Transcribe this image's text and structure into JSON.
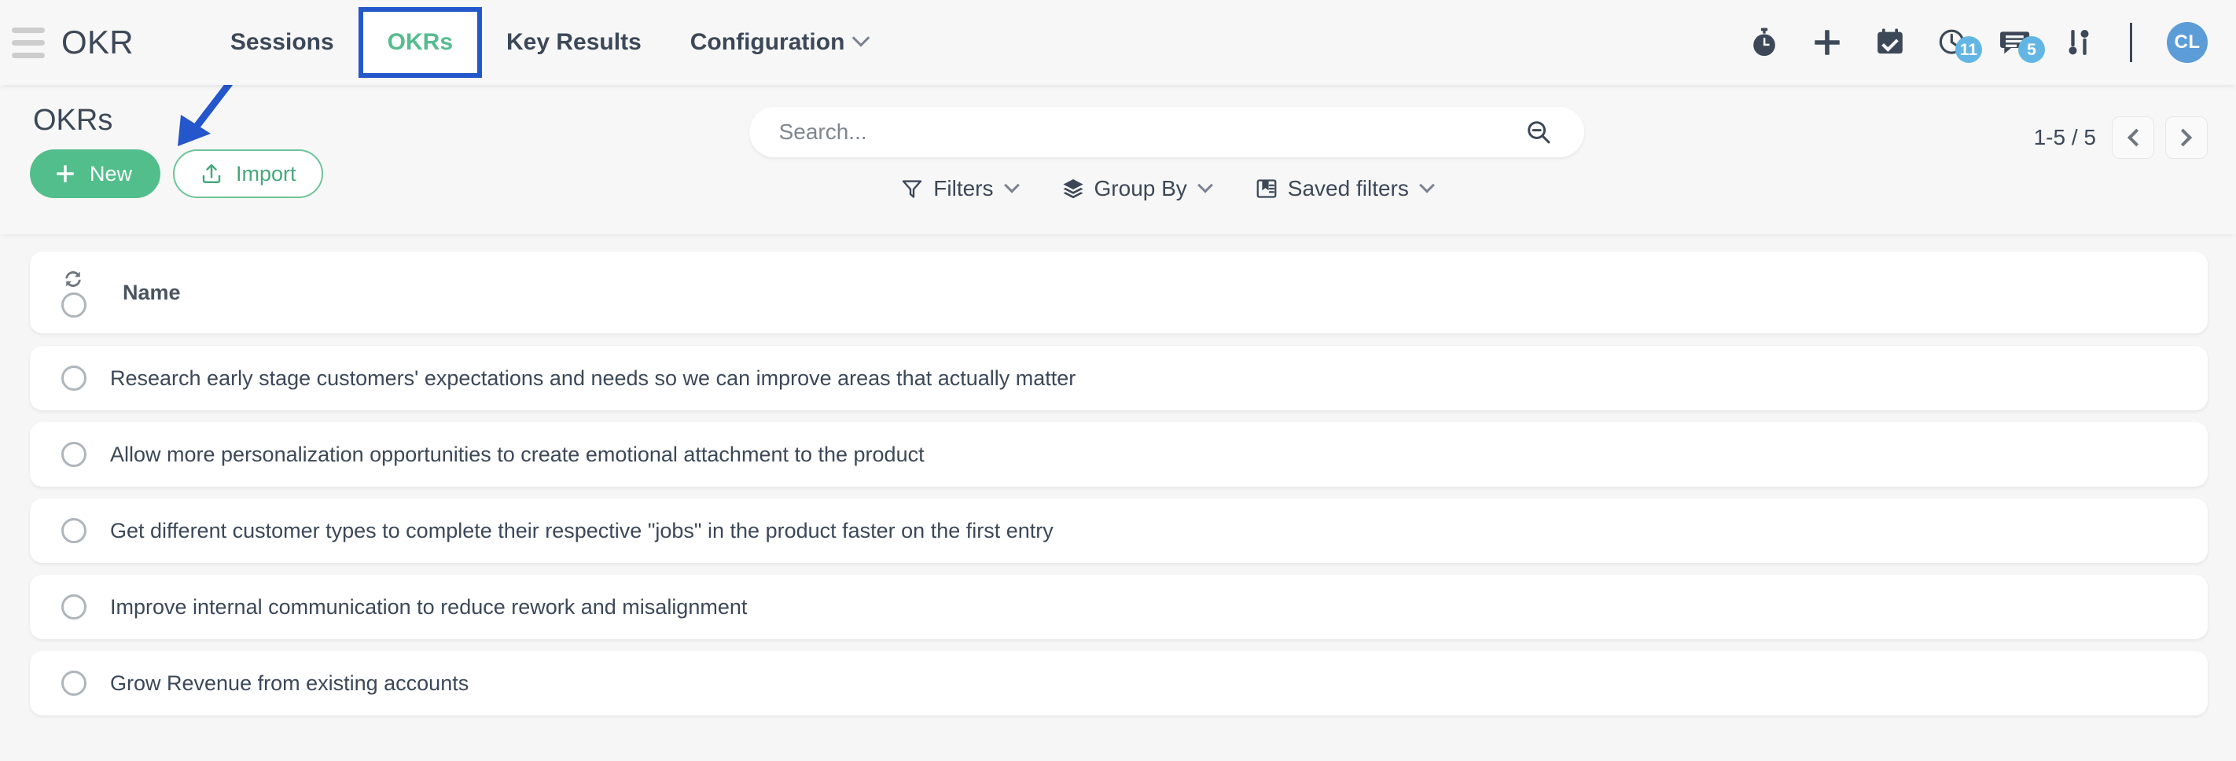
{
  "navbar": {
    "menu_icon": "hamburger-icon",
    "brand": "OKR",
    "items": [
      {
        "label": "Sessions",
        "active": false,
        "has_chevron": false,
        "highlighted": false
      },
      {
        "label": "OKRs",
        "active": true,
        "has_chevron": false,
        "highlighted": true
      },
      {
        "label": "Key Results",
        "active": false,
        "has_chevron": false,
        "highlighted": false
      },
      {
        "label": "Configuration",
        "active": false,
        "has_chevron": true,
        "highlighted": false
      }
    ],
    "tools": [
      {
        "name": "stopwatch-icon",
        "badge": null
      },
      {
        "name": "plus-icon",
        "badge": null
      },
      {
        "name": "calendar-check-icon",
        "badge": null
      },
      {
        "name": "clock-activity-icon",
        "badge": "11"
      },
      {
        "name": "messages-icon",
        "badge": "5"
      },
      {
        "name": "sliders-icon",
        "badge": null
      }
    ],
    "avatar": "CL"
  },
  "control_panel": {
    "title": "OKRs",
    "new_label": "New",
    "import_label": "Import",
    "annotation": "blue-arrow-pointing-to-new-button"
  },
  "search": {
    "value": "",
    "placeholder": "Search...",
    "icon": "search-minus-icon"
  },
  "filters": [
    {
      "label": "Filters",
      "icon": "funnel-icon"
    },
    {
      "label": "Group By",
      "icon": "layers-icon"
    },
    {
      "label": "Saved filters",
      "icon": "saved-filters-icon"
    }
  ],
  "pagination": {
    "range": "1-5 / 5",
    "prev_label": "previous-page",
    "next_label": "next-page"
  },
  "table": {
    "refresh_icon": "refresh-icon",
    "columns": [
      "Name"
    ],
    "rows": [
      {
        "name": "Research early stage customers' expectations and needs so we can improve areas that actually matter"
      },
      {
        "name": "Allow more personalization opportunities to create emotional attachment to the product"
      },
      {
        "name": "Get different customer types to complete their respective \"jobs\" in the product faster on the first entry"
      },
      {
        "name": "Improve internal communication to reduce rework and misalignment"
      },
      {
        "name": "Grow Revenue from existing accounts"
      }
    ]
  },
  "colors": {
    "accent_green": "#52BE8C",
    "highlight_blue": "#2456CC",
    "badge_blue": "#63B6E4",
    "avatar_blue": "#5C9DD7",
    "text_dark": "#3C4858",
    "page_bg": "#F6F6F6"
  }
}
